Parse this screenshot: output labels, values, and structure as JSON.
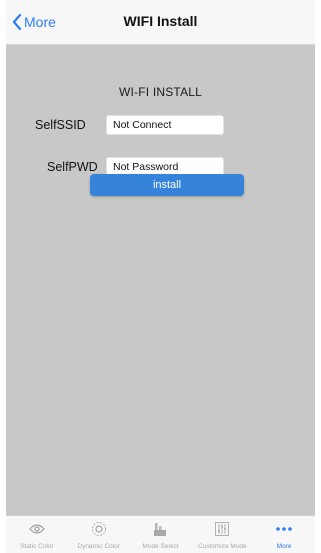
{
  "nav": {
    "back_label": "More",
    "title": "WIFI Install"
  },
  "form": {
    "heading": "WI-FI INSTALL",
    "ssid_label": "SelfSSID",
    "ssid_value": "Not Connect",
    "pwd_label": "SelfPWD",
    "pwd_value": "Not Password",
    "install_label": "install"
  },
  "tabs": [
    {
      "label": "Static Color",
      "icon": "eye-icon"
    },
    {
      "label": "Dynamic Color",
      "icon": "eye-icon"
    },
    {
      "label": "Mode Select",
      "icon": "mode-select-icon"
    },
    {
      "label": "Customize Mode",
      "icon": "equalizer-icon"
    },
    {
      "label": "More",
      "icon": "more-dots-icon",
      "active": true
    }
  ],
  "colors": {
    "accent": "#2d7cf6",
    "button": "#3584d9",
    "content_bg": "#c8c8c9"
  }
}
